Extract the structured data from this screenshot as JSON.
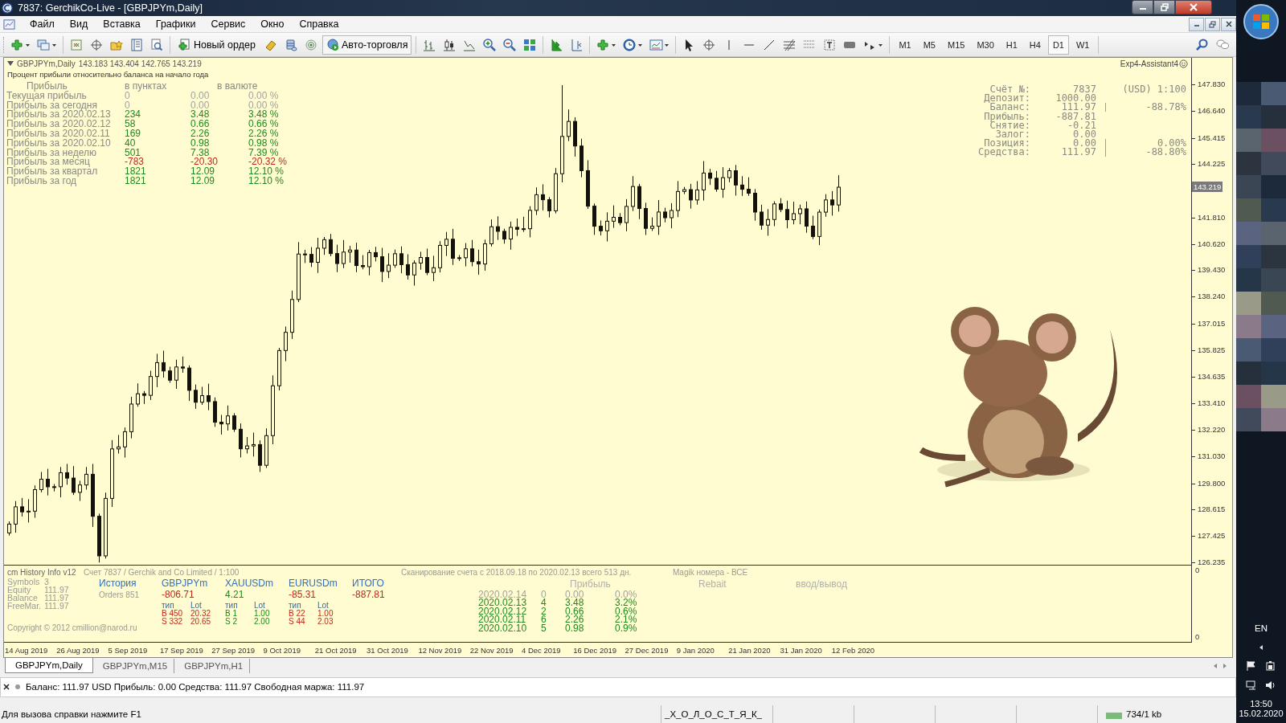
{
  "window": {
    "title": "7837: GerchikCo-Live - [GBPJPYm,Daily]"
  },
  "menu": [
    "Файл",
    "Вид",
    "Вставка",
    "Графики",
    "Сервис",
    "Окно",
    "Справка"
  ],
  "toolbar": {
    "new_order": "Новый ордер",
    "auto_trading": {
      "label": "Авто-торговля",
      "on": true
    },
    "timeframes": [
      {
        "label": "M1",
        "selected": false
      },
      {
        "label": "M5",
        "selected": false
      },
      {
        "label": "M15",
        "selected": false
      },
      {
        "label": "M30",
        "selected": false
      },
      {
        "label": "H1",
        "selected": false
      },
      {
        "label": "H4",
        "selected": false
      },
      {
        "label": "D1",
        "selected": true
      },
      {
        "label": "W1",
        "selected": false
      }
    ]
  },
  "chart": {
    "symbol": "GBPJPYm,Daily",
    "ohlc": "143.183 143.404 142.765 143.219",
    "expert": "Exp4-Assistant4",
    "profit_table": {
      "title": "Процент прибыли относительно баланса на начало года",
      "header": [
        "Прибыль",
        "в пунктах",
        "в валюте"
      ],
      "rows": [
        {
          "label": "Текущая прибыль",
          "points": "0",
          "amount": "0.00",
          "percent": "0.00 %",
          "color": "#a3a39a"
        },
        {
          "label": "Прибыль за сегодня",
          "points": "0",
          "amount": "0.00",
          "percent": "0.00 %",
          "color": "#a3a39a"
        },
        {
          "label": "Прибыль за 2020.02.13",
          "points": "234",
          "amount": "3.48",
          "percent": "3.48 %",
          "color": "#1d8a1d"
        },
        {
          "label": "Прибыль за 2020.02.12",
          "points": "58",
          "amount": "0.66",
          "percent": "0.66 %",
          "color": "#1d8a1d"
        },
        {
          "label": "Прибыль за 2020.02.11",
          "points": "169",
          "amount": "2.26",
          "percent": "2.26 %",
          "color": "#1d8a1d"
        },
        {
          "label": "Прибыль за 2020.02.10",
          "points": "40",
          "amount": "0.98",
          "percent": "0.98 %",
          "color": "#1d8a1d"
        },
        {
          "label": "Прибыль за неделю",
          "points": "501",
          "amount": "7.38",
          "percent": "7.39 %",
          "color": "#1d8a1d"
        },
        {
          "label": "Прибыль за месяц",
          "points": "-783",
          "amount": "-20.30",
          "percent": "-20.32 %",
          "color": "#c0281c"
        },
        {
          "label": "Прибыль за квартал",
          "points": "1821",
          "amount": "12.09",
          "percent": "12.10 %",
          "color": "#1d8a1d"
        },
        {
          "label": "Прибыль за год",
          "points": "1821",
          "amount": "12.09",
          "percent": "12.10 %",
          "color": "#1d8a1d"
        }
      ]
    },
    "account": [
      {
        "label": "Счёт №:",
        "value": "7837",
        "divider": false,
        "note": "(USD) 1:100"
      },
      {
        "label": "Депозит:",
        "value": "1000.00",
        "divider": false
      },
      {
        "label": "Баланс:",
        "value": "111.97",
        "divider": true,
        "note": "-88.78%"
      },
      {
        "label": "Прибыль:",
        "value": "-887.81",
        "divider": false
      },
      {
        "label": "Снятие:",
        "value": "-0.21",
        "divider": false
      },
      {
        "label": "Залог:",
        "value": "0.00",
        "divider": false
      },
      {
        "label": "Позиция:",
        "value": "0.00",
        "divider": true,
        "note": "0.00%"
      },
      {
        "label": "Средства:",
        "value": "111.97",
        "divider": true,
        "note": "-88.80%"
      }
    ],
    "price_ticks": [
      "147.830",
      "146.640",
      "145.415",
      "144.225",
      "141.810",
      "140.620",
      "139.430",
      "138.240",
      "137.015",
      "135.825",
      "134.635",
      "133.410",
      "132.220",
      "131.030",
      "129.800",
      "128.615",
      "127.425",
      "126.235"
    ],
    "current_price": "143.219",
    "time_labels": [
      "14 Aug 2019",
      "26 Aug 2019",
      "5 Sep 2019",
      "17 Sep 2019",
      "27 Sep 2019",
      "9 Oct 2019",
      "21 Oct 2019",
      "31 Oct 2019",
      "12 Nov 2019",
      "22 Nov 2019",
      "4 Dec 2019",
      "16 Dec 2019",
      "27 Dec 2019",
      "9 Jan 2020",
      "21 Jan 2020",
      "31 Jan 2020",
      "12 Feb 2020"
    ]
  },
  "history_panel": {
    "name": "cm History Info v12",
    "account": "Счет 7837 / Gerchik and Co Limited / 1:100",
    "scan": "Сканирование счета с 2018.09.18 по 2020.02.13 всего 513 дн.",
    "magic": "Magik номера - ВСЕ",
    "summary": [
      {
        "label": "Symbols",
        "value": "3"
      },
      {
        "label": "Equity",
        "value": "111.97"
      },
      {
        "label": "Balance",
        "value": "111.97"
      },
      {
        "label": "FreeMar.",
        "value": "111.97"
      }
    ],
    "history": {
      "title": "История",
      "orders": "Orders 851"
    },
    "symbols": [
      {
        "name": "GBPJPYm",
        "total": "-806.71",
        "color": "#c0281c",
        "type_head": "тип",
        "lot_head": "Lot",
        "rows": [
          {
            "type": "B 450",
            "lot": "20.32"
          },
          {
            "type": "S 332",
            "lot": "20.65"
          }
        ]
      },
      {
        "name": "XAUUSDm",
        "total": "4.21",
        "color": "#1d8a1d",
        "type_head": "тип",
        "lot_head": "Lot",
        "rows": [
          {
            "type": "B 1",
            "lot": "1.00"
          },
          {
            "type": "S 2",
            "lot": "2.00"
          }
        ]
      },
      {
        "name": "EURUSDm",
        "total": "-85.31",
        "color": "#c0281c",
        "type_head": "тип",
        "lot_head": "Lot",
        "rows": [
          {
            "type": "B 22",
            "lot": "1.00"
          },
          {
            "type": "S 44",
            "lot": "2.03"
          }
        ]
      }
    ],
    "total": {
      "label": "ИТОГО",
      "value": "-887.81",
      "color": "#c0281c"
    },
    "copyright": "Copyright © 2012 cmillion@narod.ru",
    "daily_headers": [
      "Прибыль",
      "Rebait",
      "ввод/вывод"
    ],
    "daily": [
      {
        "date": "2020.02.14",
        "count": "0",
        "amount": "0.00",
        "percent": "0.0%",
        "color": "#a3a39a"
      },
      {
        "date": "2020.02.13",
        "count": "4",
        "amount": "3.48",
        "percent": "3.2%",
        "color": "#1d8a1d"
      },
      {
        "date": "2020.02.12",
        "count": "2",
        "amount": "0.66",
        "percent": "0.6%",
        "color": "#1d8a1d"
      },
      {
        "date": "2020.02.11",
        "count": "6",
        "amount": "2.26",
        "percent": "2.1%",
        "color": "#1d8a1d"
      },
      {
        "date": "2020.02.10",
        "count": "5",
        "amount": "0.98",
        "percent": "0.9%",
        "color": "#1d8a1d"
      }
    ],
    "axis": [
      "0",
      "0"
    ]
  },
  "tabs": [
    {
      "label": "GBPJPYm,Daily",
      "selected": true
    },
    {
      "label": "GBPJPYm,M15",
      "selected": false
    },
    {
      "label": "GBPJPYm,H1",
      "selected": false
    }
  ],
  "terminal": "Баланс: 111.97 USD  Прибыль: 0.00  Средства: 111.97  Свободная маржа: 111.97",
  "status_bar": {
    "help": "Для вызова справки нажмите F1",
    "profile": "_Х_О_Л_О_С_Т_Я_К_",
    "traffic": "734/1 kb"
  },
  "taskbar": {
    "language": "EN",
    "time": "13:50",
    "date": "15.02.2020"
  }
}
